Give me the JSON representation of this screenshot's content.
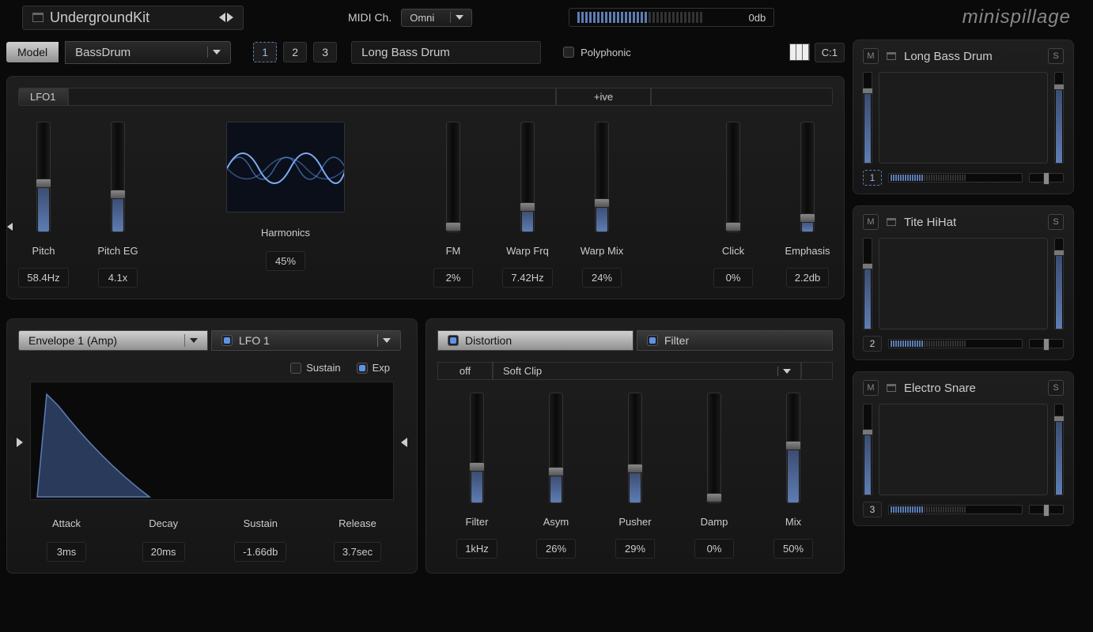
{
  "preset_name": "UndergroundKit",
  "midi_label": "MIDI Ch.",
  "midi_channel": "Omni",
  "output_db": "0db",
  "brand": "minispillage",
  "model": {
    "label": "Model",
    "value": "BassDrum"
  },
  "slots": [
    "1",
    "2",
    "3"
  ],
  "active_slot": 0,
  "voice_name": "Long Bass Drum",
  "polyphonic_label": "Polyphonic",
  "note": "C:1",
  "lfo_header": {
    "main": "LFO1",
    "polarity": "+ive"
  },
  "osc_params": {
    "pitch": {
      "label": "Pitch",
      "value": "58.4Hz",
      "pos": 0.42
    },
    "pitch_eg": {
      "label": "Pitch EG",
      "value": "4.1x",
      "pos": 0.32
    },
    "harmonics": {
      "label": "Harmonics",
      "value": "45%"
    },
    "fm": {
      "label": "FM",
      "value": "2%",
      "pos": 0.02
    },
    "warp_frq": {
      "label": "Warp Frq",
      "value": "7.42Hz",
      "pos": 0.2
    },
    "warp_mix": {
      "label": "Warp Mix",
      "value": "24%",
      "pos": 0.24
    },
    "click": {
      "label": "Click",
      "value": "0%",
      "pos": 0.0
    },
    "emphasis": {
      "label": "Emphasis",
      "value": "2.2db",
      "pos": 0.1
    }
  },
  "env": {
    "selector": "Envelope 1 (Amp)",
    "lfo_selector": "LFO 1",
    "sustain_opt": "Sustain",
    "exp_opt": "Exp",
    "attack": {
      "label": "Attack",
      "value": "3ms"
    },
    "decay": {
      "label": "Decay",
      "value": "20ms"
    },
    "sustain": {
      "label": "Sustain",
      "value": "-1.66db"
    },
    "release": {
      "label": "Release",
      "value": "3.7sec"
    }
  },
  "fx": {
    "distortion_label": "Distortion",
    "filter_label": "Filter",
    "off_label": "off",
    "mode": "Soft Clip",
    "filter": {
      "label": "Filter",
      "value": "1kHz",
      "pos": 0.3
    },
    "asym": {
      "label": "Asym",
      "value": "26%",
      "pos": 0.26
    },
    "pusher": {
      "label": "Pusher",
      "value": "29%",
      "pos": 0.29
    },
    "damp": {
      "label": "Damp",
      "value": "0%",
      "pos": 0.0
    },
    "mix": {
      "label": "Mix",
      "value": "50%",
      "pos": 0.5
    }
  },
  "pads": [
    {
      "slot": "1",
      "name": "Long Bass Drum",
      "active": true,
      "vol": 0.85,
      "pitch": 0.8
    },
    {
      "slot": "2",
      "name": "Tite HiHat",
      "active": false,
      "vol": 0.85,
      "pitch": 0.7
    },
    {
      "slot": "3",
      "name": "Electro Snare",
      "active": false,
      "vol": 0.85,
      "pitch": 0.7
    }
  ]
}
